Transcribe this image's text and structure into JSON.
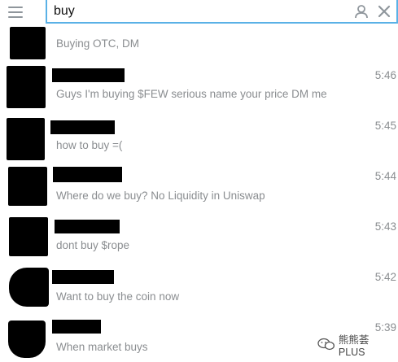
{
  "search": {
    "value": "buy"
  },
  "results": [
    {
      "message": "Buying OTC, DM",
      "time": ""
    },
    {
      "message": "Guys I'm buying $FEW serious name your price DM me",
      "time": "5:46"
    },
    {
      "message": "how to buy =(",
      "time": "5:45"
    },
    {
      "message": "Where do we buy?  No Liquidity in Uniswap",
      "time": "5:44"
    },
    {
      "message": "dont buy $rope",
      "time": "5:43"
    },
    {
      "message": "Want to buy the coin now",
      "time": "5:42"
    },
    {
      "message": "When market buys",
      "time": "5:39"
    }
  ],
  "watermark": {
    "text": "熊熊荟 PLUS"
  },
  "colors": {
    "accent": "#5ab1e6",
    "muted_text": "#8a8d90",
    "redacted": "#000000"
  }
}
